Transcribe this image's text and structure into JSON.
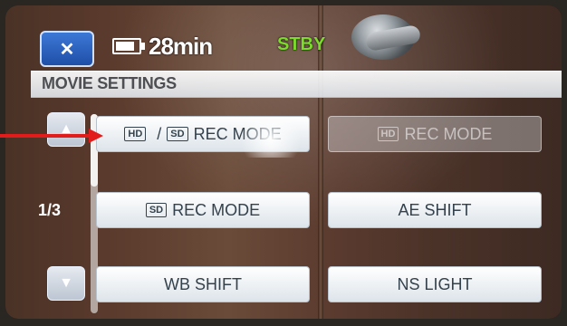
{
  "topbar": {
    "close_label": "✕",
    "battery_icon": "battery-icon",
    "remaining_time": "28min",
    "status": "STBY"
  },
  "title": "MOVIE SETTINGS",
  "pagination": {
    "page_indicator": "1/3",
    "up_arrow": "▲",
    "down_arrow": "▼"
  },
  "menu": {
    "items": [
      {
        "badge_hd": "HD",
        "sep": "/",
        "badge_sd": "SD",
        "label": "REC MODE",
        "state": "selected"
      },
      {
        "badge_hd": "HD",
        "label": "REC MODE",
        "state": "disabled"
      },
      {
        "badge_sd": "SD",
        "label": "REC MODE",
        "state": "enabled"
      },
      {
        "label": "AE SHIFT",
        "state": "enabled"
      },
      {
        "label": "WB SHIFT",
        "state": "enabled"
      },
      {
        "label": "NS LIGHT",
        "state": "enabled"
      }
    ]
  },
  "colors": {
    "stby": "#7bdc2a",
    "arrow": "#e21b1b",
    "close_button": "#1f4fa8"
  }
}
